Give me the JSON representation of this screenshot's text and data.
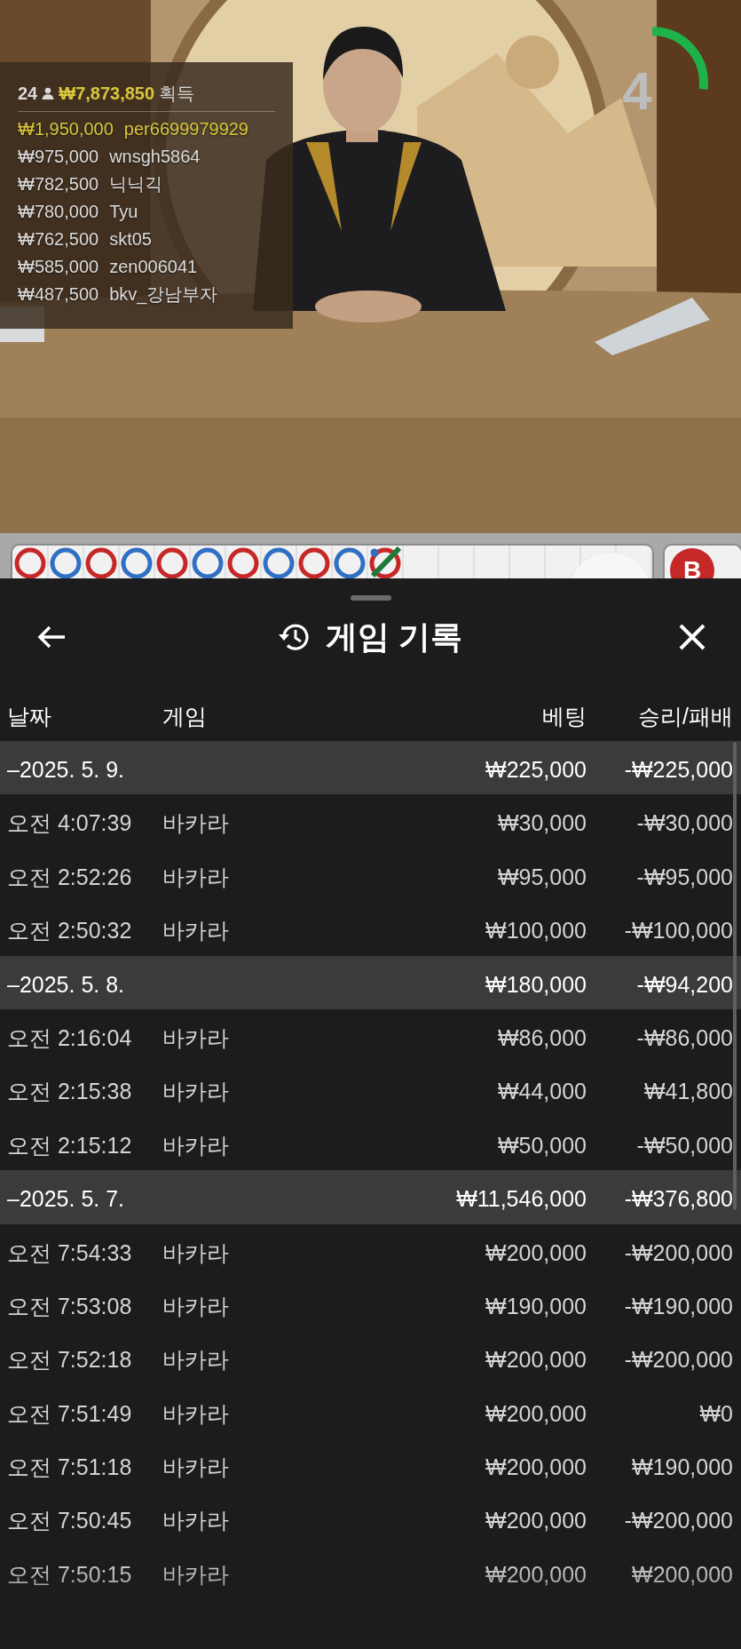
{
  "timer": {
    "count": "4",
    "level": 0.27
  },
  "leaderboard": {
    "players": "24",
    "total": "₩7,873,850",
    "total_label": "획득",
    "entries": [
      {
        "amount": "₩1,950,000",
        "name": "per6699979929",
        "highlighted": true
      },
      {
        "amount": "₩975,000",
        "name": "wnsgh5864",
        "highlighted": false
      },
      {
        "amount": "₩782,500",
        "name": "닉닉긱",
        "highlighted": false
      },
      {
        "amount": "₩780,000",
        "name": "Tyu",
        "highlighted": false
      },
      {
        "amount": "₩762,500",
        "name": "skt05",
        "highlighted": false
      },
      {
        "amount": "₩585,000",
        "name": "zen006041",
        "highlighted": false
      },
      {
        "amount": "₩487,500",
        "name": "bkv_강남부자",
        "highlighted": false
      }
    ]
  },
  "bead_road": {
    "beads": [
      {
        "color": "#c62828",
        "tie": false,
        "pair": false
      },
      {
        "color": "#2f6fc4",
        "tie": false,
        "pair": false
      },
      {
        "color": "#c62828",
        "tie": false,
        "pair": false
      },
      {
        "color": "#2f6fc4",
        "tie": false,
        "pair": false
      },
      {
        "color": "#c62828",
        "tie": false,
        "pair": false
      },
      {
        "color": "#2f6fc4",
        "tie": false,
        "pair": false
      },
      {
        "color": "#c62828",
        "tie": false,
        "pair": false
      },
      {
        "color": "#2f6fc4",
        "tie": false,
        "pair": false
      },
      {
        "color": "#c62828",
        "tie": false,
        "pair": false
      },
      {
        "color": "#2f6fc4",
        "tie": false,
        "pair": false
      },
      {
        "color": "#c62828",
        "tie": true,
        "pair": true
      }
    ]
  },
  "side_badge": "B",
  "sheet": {
    "title": "게임 기록",
    "columns": [
      "날짜",
      "게임",
      "베팅",
      "승리/패배"
    ],
    "groups": [
      {
        "date": "–2025. 5. 9.",
        "bet": "₩225,000",
        "result": "-₩225,000",
        "rows": [
          {
            "time": "오전 4:07:39",
            "game": "바카라",
            "bet": "₩30,000",
            "result": "-₩30,000"
          },
          {
            "time": "오전 2:52:26",
            "game": "바카라",
            "bet": "₩95,000",
            "result": "-₩95,000"
          },
          {
            "time": "오전 2:50:32",
            "game": "바카라",
            "bet": "₩100,000",
            "result": "-₩100,000"
          }
        ]
      },
      {
        "date": "–2025. 5. 8.",
        "bet": "₩180,000",
        "result": "-₩94,200",
        "rows": [
          {
            "time": "오전 2:16:04",
            "game": "바카라",
            "bet": "₩86,000",
            "result": "-₩86,000"
          },
          {
            "time": "오전 2:15:38",
            "game": "바카라",
            "bet": "₩44,000",
            "result": "₩41,800"
          },
          {
            "time": "오전 2:15:12",
            "game": "바카라",
            "bet": "₩50,000",
            "result": "-₩50,000"
          }
        ]
      },
      {
        "date": "–2025. 5. 7.",
        "bet": "₩11,546,000",
        "result": "-₩376,800",
        "rows": [
          {
            "time": "오전 7:54:33",
            "game": "바카라",
            "bet": "₩200,000",
            "result": "-₩200,000"
          },
          {
            "time": "오전 7:53:08",
            "game": "바카라",
            "bet": "₩190,000",
            "result": "-₩190,000"
          },
          {
            "time": "오전 7:52:18",
            "game": "바카라",
            "bet": "₩200,000",
            "result": "-₩200,000"
          },
          {
            "time": "오전 7:51:49",
            "game": "바카라",
            "bet": "₩200,000",
            "result": "₩0"
          },
          {
            "time": "오전 7:51:18",
            "game": "바카라",
            "bet": "₩200,000",
            "result": "₩190,000"
          },
          {
            "time": "오전 7:50:45",
            "game": "바카라",
            "bet": "₩200,000",
            "result": "-₩200,000"
          },
          {
            "time": "오전 7:50:15",
            "game": "바카라",
            "bet": "₩200,000",
            "result": "₩200,000"
          }
        ]
      }
    ]
  }
}
